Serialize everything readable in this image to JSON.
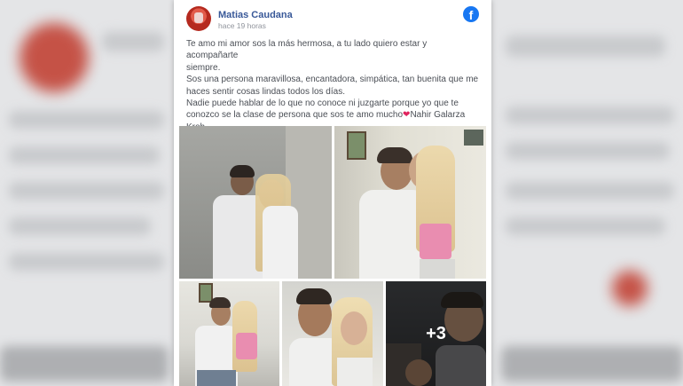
{
  "post": {
    "author": "Matias Caudana",
    "time": "hace 19 horas",
    "network_icon": "facebook-icon",
    "text_lines": [
      "Te amo mi amor sos la más hermosa, a tu lado quiero estar y acompañarte",
      "siempre.",
      "Sos una persona maravillosa, encantadora, simpática, tan buenita que me",
      "haces sentir cosas lindas todos los días.",
      "Nadie puede hablar de lo que no conoce ni juzgarte porque yo que te"
    ],
    "last_line_before_heart": "conozco se la clase de persona que sos te amo mucho",
    "heart_glyph": "❤",
    "tagged_name_part1": "Nahir Galarza",
    "tagged_name_part2": "Kroh",
    "more_photos_label": "+3"
  },
  "colors": {
    "link": "#385898",
    "facebook_blue": "#1877f2",
    "heart": "#e0245e"
  }
}
